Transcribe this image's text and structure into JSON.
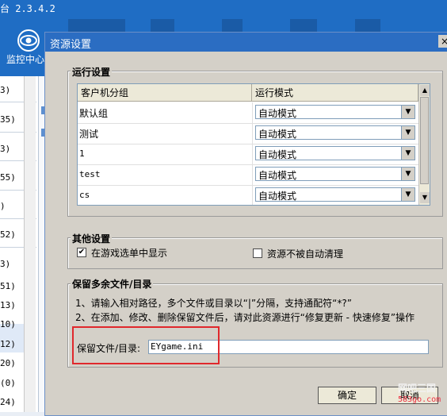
{
  "app": {
    "title_fragment": "台 2.3.4.2",
    "monitor_label": "监控中心"
  },
  "left_list": {
    "rows": [
      "3)",
      "35)",
      "3)",
      "55)",
      ")",
      "52)",
      "3)",
      "51)",
      "13)",
      "10)",
      "12)",
      "20)",
      "(0)",
      "24)"
    ]
  },
  "dialog": {
    "title": "资源设置",
    "close_glyph": "×",
    "run_settings": {
      "title": "运行设置",
      "col_group": "客户机分组",
      "col_mode": "运行模式",
      "rows": [
        {
          "group": "默认组",
          "mode": "自动模式"
        },
        {
          "group": "测试",
          "mode": "自动模式"
        },
        {
          "group": "1",
          "mode": "自动模式"
        },
        {
          "group": "test",
          "mode": "自动模式"
        },
        {
          "group": "cs",
          "mode": "自动模式"
        }
      ]
    },
    "other_settings": {
      "title": "其他设置",
      "show_in_menu": "在游戏选单中显示",
      "show_in_menu_checked": "✔",
      "no_auto_clean": "资源不被自动清理"
    },
    "keep_files": {
      "title": "保留多余文件/目录",
      "hint1": "1、请输入相对路径，多个文件或目录以“|”分隔，支持通配符“*?”",
      "hint2": "2、在添加、修改、删除保留文件后，请对此资源进行“修复更新 - 快速修复”操作",
      "field_label": "保留文件/目录:",
      "field_value": "EYgame.ini"
    },
    "ok": "确定",
    "cancel": "取消"
  },
  "watermark": {
    "text": "网吧三国",
    "url": "583go.com"
  }
}
